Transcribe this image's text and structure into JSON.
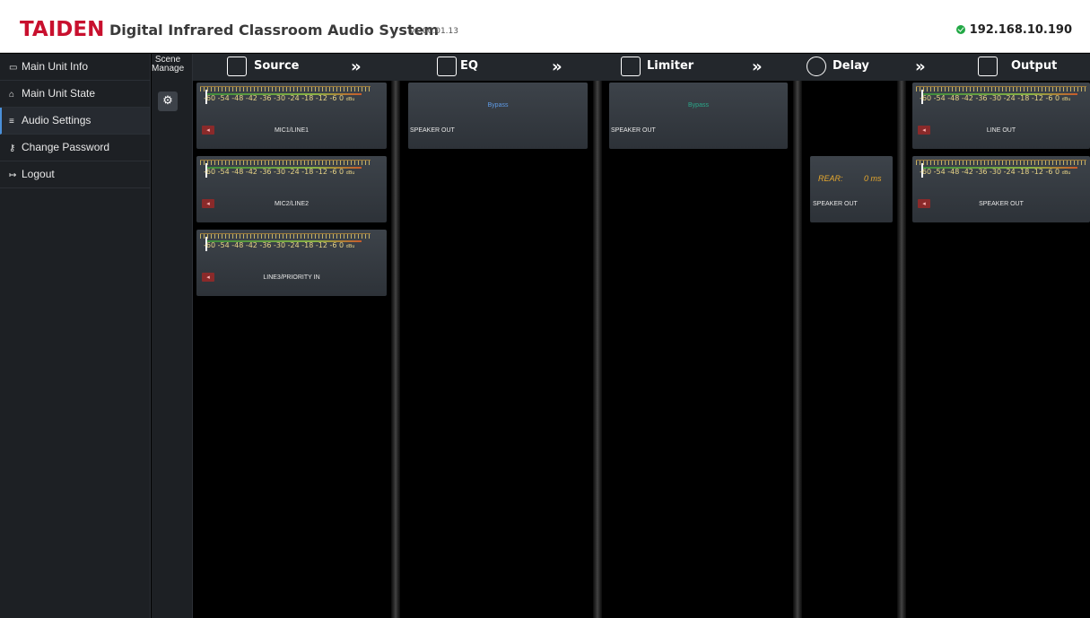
{
  "header": {
    "brand": "TAIDEN",
    "title": "Digital Infrared Classroom Audio System",
    "version": "v1.00.01.13",
    "ip": "192.168.10.190"
  },
  "sidebar": {
    "items": [
      {
        "label": "Main Unit Info",
        "icon": "monitor-icon"
      },
      {
        "label": "Main Unit State",
        "icon": "home-icon"
      },
      {
        "label": "Audio Settings",
        "icon": "sliders-icon",
        "active": true
      },
      {
        "label": "Change Password",
        "icon": "key-icon"
      },
      {
        "label": "Logout",
        "icon": "logout-icon"
      }
    ]
  },
  "scene": {
    "label_line1": "Scene",
    "label_line2": "Manage",
    "button_icon": "gears-icon"
  },
  "stages": {
    "source": "Source",
    "eq": "EQ",
    "limiter": "Limiter",
    "delay": "Delay",
    "output": "Output",
    "chevron": "»"
  },
  "meter": {
    "scale": "-60 -54 -48 -42 -36 -30 -24 -18 -12  -6   0",
    "unit": "dBu"
  },
  "sources": [
    {
      "name": "MIC1/LINE1"
    },
    {
      "name": "MIC2/LINE2"
    },
    {
      "name": "LINE3/PRIORITY IN"
    }
  ],
  "eq": {
    "status": "Bypass",
    "channel": "SPEAKER OUT"
  },
  "limiter": {
    "status": "Bypass",
    "channel": "SPEAKER OUT"
  },
  "delay": {
    "label": "REAR:",
    "value": "0 ms",
    "channel": "SPEAKER OUT"
  },
  "outputs": [
    {
      "name": "LINE OUT"
    },
    {
      "name": "SPEAKER OUT"
    }
  ],
  "colors": {
    "brand": "#c8102e",
    "online": "#22a845",
    "bypass_blue": "#5f9be5",
    "bypass_green": "#2ba88a",
    "delay": "#e5a72e"
  }
}
